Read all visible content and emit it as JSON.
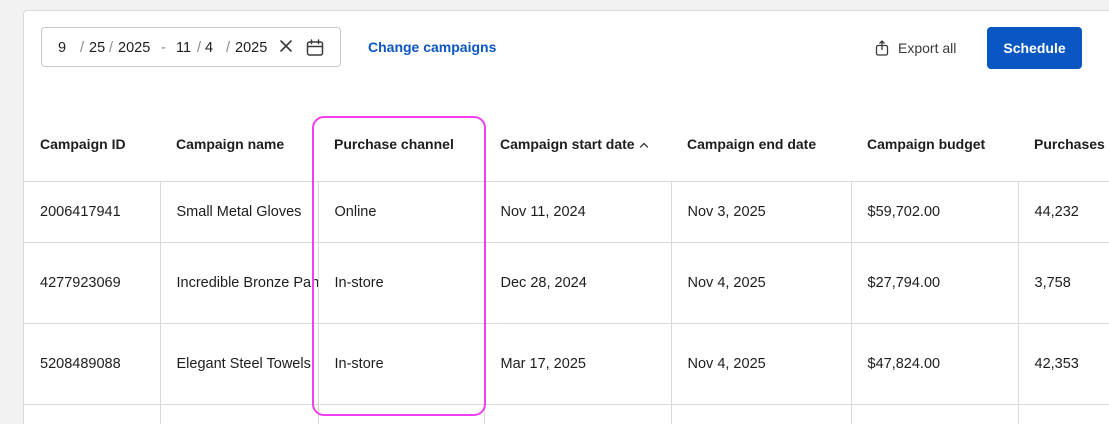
{
  "date_range": {
    "start_month": "9",
    "start_day": "25",
    "start_year": "2025",
    "end_month": "11",
    "end_day": "4",
    "end_year": "2025",
    "date_sep": "/",
    "range_sep": "-"
  },
  "toolbar": {
    "change_campaigns_label": "Change campaigns",
    "export_label": "Export all",
    "schedule_label": "Schedule",
    "clear_icon": "close-icon",
    "calendar_icon": "calendar-icon",
    "export_icon": "export-icon"
  },
  "table": {
    "columns": [
      "Campaign ID",
      "Campaign name",
      "Purchase channel",
      "Campaign start date",
      "Campaign end date",
      "Campaign budget",
      "Purchases"
    ],
    "sorted_column": "Campaign start date",
    "sort_direction": "ascending",
    "rows": [
      [
        "2006417941",
        "Small Metal Gloves",
        "Online",
        "Nov 11, 2024",
        "Nov 3, 2025",
        "$59,702.00",
        "44,232"
      ],
      [
        "4277923069",
        "Incredible Bronze Pants",
        "In-store",
        "Dec 28, 2024",
        "Nov 4, 2025",
        "$27,794.00",
        "3,758"
      ],
      [
        "5208489088",
        "Elegant Steel Towels",
        "In-store",
        "Mar 17, 2025",
        "Nov 4, 2025",
        "$47,824.00",
        "42,353"
      ]
    ]
  },
  "colors": {
    "accent": "#0a56c2",
    "highlight": "#f03ff0",
    "border": "#d9d9dc"
  }
}
